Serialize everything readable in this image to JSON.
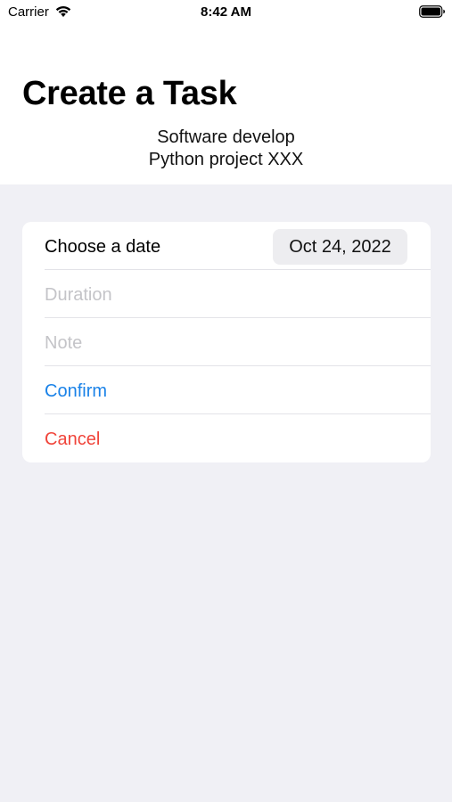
{
  "status_bar": {
    "carrier": "Carrier",
    "time": "8:42 AM",
    "icons": [
      "wifi-icon",
      "battery-icon"
    ]
  },
  "header": {
    "title": "Create a Task",
    "subtitle_line1": "Software develop",
    "subtitle_line2": "Python project XXX"
  },
  "form": {
    "date_label": "Choose a date",
    "date_value": "Oct 24, 2022",
    "duration_placeholder": "Duration",
    "note_placeholder": "Note",
    "confirm_label": "Confirm",
    "cancel_label": "Cancel"
  },
  "colors": {
    "background": "#f0f0f5",
    "card": "#ffffff",
    "confirm": "#1a82e8",
    "cancel": "#f0443a",
    "placeholder": "#c4c4c8"
  }
}
